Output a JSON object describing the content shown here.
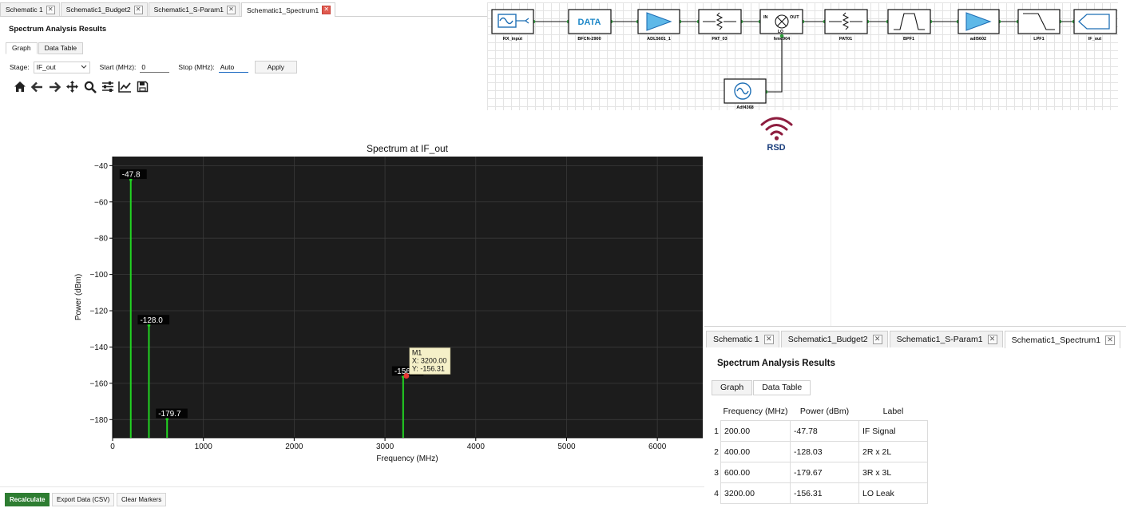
{
  "left_window": {
    "tabs": [
      {
        "label": "Schematic 1",
        "active": false
      },
      {
        "label": "Schematic1_Budget2",
        "active": false
      },
      {
        "label": "Schematic1_S-Param1",
        "active": false
      },
      {
        "label": "Schematic1_Spectrum1",
        "active": true
      }
    ],
    "panel_title": "Spectrum Analysis Results",
    "subtabs": [
      "Graph",
      "Data Table"
    ],
    "controls": {
      "stage_label": "Stage:",
      "stage_value": "IF_out",
      "start_label": "Start (MHz):",
      "start_value": "0",
      "stop_label": "Stop (MHz):",
      "stop_value": "Auto",
      "apply_label": "Apply"
    },
    "toolbar_icons": [
      "home-icon",
      "back-arrow-icon",
      "forward-arrow-icon",
      "pan-icon",
      "zoom-icon",
      "configure-subplots-icon",
      "edit-axis-icon",
      "save-icon"
    ],
    "bottom_buttons": {
      "recalculate": "Recalculate",
      "export": "Export Data (CSV)",
      "clear": "Clear Markers"
    }
  },
  "chart_data": {
    "type": "bar",
    "title": "Spectrum at IF_out",
    "xlabel": "Frequency (MHz)",
    "ylabel": "Power (dBm)",
    "xlim": [
      0,
      6500
    ],
    "ylim": [
      -190,
      -35
    ],
    "xticks": [
      0,
      1000,
      2000,
      3000,
      4000,
      5000,
      6000
    ],
    "yticks": [
      -40,
      -60,
      -80,
      -100,
      -120,
      -140,
      -160,
      -180
    ],
    "grid": true,
    "points": [
      {
        "x": 200,
        "y": -47.78,
        "label": "-47.8"
      },
      {
        "x": 400,
        "y": -128.03,
        "label": "-128.0"
      },
      {
        "x": 600,
        "y": -179.67,
        "label": "-179.7"
      },
      {
        "x": 3200,
        "y": -156.31,
        "label": "-156.3"
      }
    ],
    "marker": {
      "name": "M1",
      "x_text": "X: 3200.00",
      "y_text": "Y: -156.31",
      "x": 3200,
      "y": -156.31
    },
    "colors": {
      "background": "#1c1c1c",
      "line": "#22d422",
      "marker": "#e53935",
      "tooltip": "#f5f0c8"
    }
  },
  "schematic": {
    "components": [
      {
        "label": "RX_input",
        "kind": "source-port"
      },
      {
        "label": "BFCN-2900",
        "kind": "data-block",
        "text": "DATA"
      },
      {
        "label": "ADL5601_1",
        "kind": "amplifier"
      },
      {
        "label": "PAT_03",
        "kind": "attenuator"
      },
      {
        "label": "hmc904",
        "kind": "mixer",
        "pins": [
          "IN",
          "OUT",
          "LO"
        ]
      },
      {
        "label": "PAT01",
        "kind": "attenuator"
      },
      {
        "label": "BPF1",
        "kind": "bandpass-filter"
      },
      {
        "label": "adl5602",
        "kind": "amplifier"
      },
      {
        "label": "LPF1",
        "kind": "lowpass-filter"
      },
      {
        "label": "IF_out",
        "kind": "output-port"
      }
    ],
    "oscillator": {
      "label": "Adf4368",
      "kind": "oscillator"
    },
    "logo_text": "RSD"
  },
  "right_window": {
    "tabs": [
      {
        "label": "Schematic 1",
        "active": false
      },
      {
        "label": "Schematic1_Budget2",
        "active": false
      },
      {
        "label": "Schematic1_S-Param1",
        "active": false
      },
      {
        "label": "Schematic1_Spectrum1",
        "active": true
      }
    ],
    "panel_title": "Spectrum Analysis Results",
    "subtabs": [
      "Graph",
      "Data Table"
    ],
    "table": {
      "headers": [
        "Frequency (MHz)",
        "Power (dBm)",
        "Label"
      ],
      "rows": [
        {
          "index": "1",
          "freq": "200.00",
          "power": "-47.78",
          "label": "IF Signal"
        },
        {
          "index": "2",
          "freq": "400.00",
          "power": "-128.03",
          "label": "2R x 2L"
        },
        {
          "index": "3",
          "freq": "600.00",
          "power": "-179.67",
          "label": "3R x 3L"
        },
        {
          "index": "4",
          "freq": "3200.00",
          "power": "-156.31",
          "label": "LO Leak"
        }
      ]
    }
  }
}
